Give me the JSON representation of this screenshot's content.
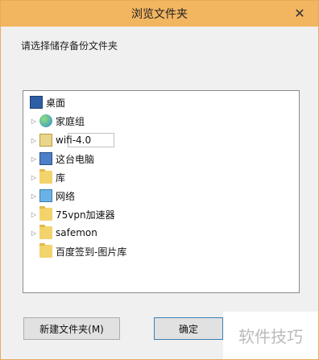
{
  "window": {
    "title": "浏览文件夹"
  },
  "dialog": {
    "prompt": "请选择储存备份文件夹"
  },
  "tree": {
    "items": [
      {
        "label": "桌面",
        "icon": "desktop-icon"
      },
      {
        "label": "家庭组",
        "icon": "homegroup-icon"
      },
      {
        "label": "wifi-4.0",
        "icon": "wifi-folder-icon"
      },
      {
        "label": "这台电脑",
        "icon": "computer-icon"
      },
      {
        "label": "库",
        "icon": "library-folder-icon"
      },
      {
        "label": "网络",
        "icon": "network-icon"
      },
      {
        "label": "75vpn加速器",
        "icon": "folder-icon"
      },
      {
        "label": "safemon",
        "icon": "folder-icon"
      },
      {
        "label": "百度签到-图片库",
        "icon": "folder-icon"
      }
    ]
  },
  "buttons": {
    "new_folder": "新建文件夹(M)",
    "ok": "确定"
  },
  "watermark": "软件技巧"
}
